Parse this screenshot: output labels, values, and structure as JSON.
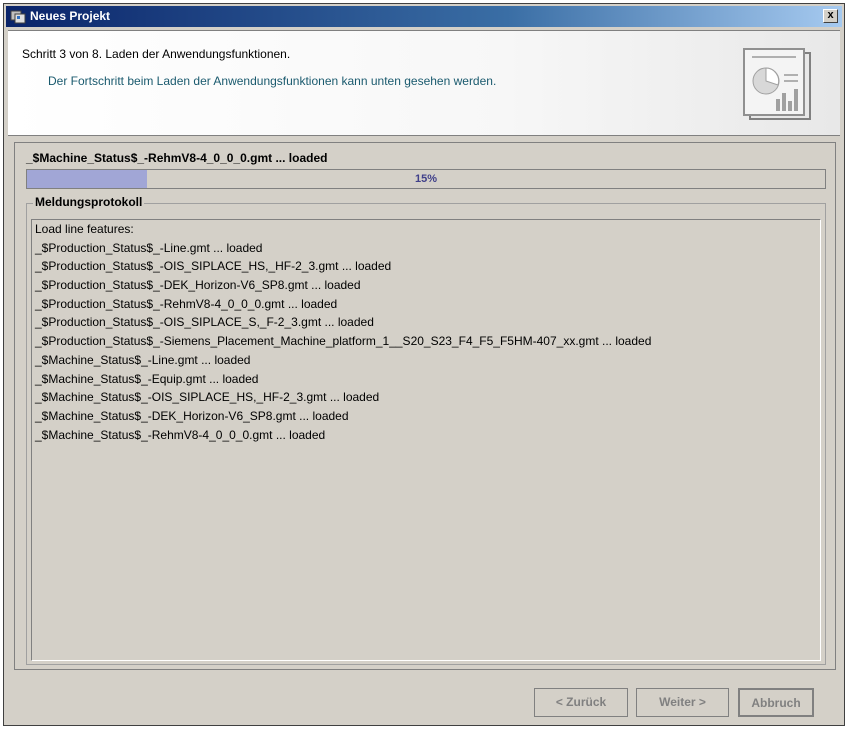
{
  "window": {
    "title": "Neues Projekt",
    "close_label": "x"
  },
  "header": {
    "step_text": "Schritt 3 von 8. Laden der Anwendungsfunktionen.",
    "sub_text": "Der Fortschritt beim Laden der Anwendungsfunktionen kann unten gesehen werden."
  },
  "status": {
    "current": "_$Machine_Status$_-RehmV8-4_0_0_0.gmt ... loaded"
  },
  "progress": {
    "label": "15%",
    "value": 0.15
  },
  "log": {
    "label": "Meldungsprotokoll",
    "lines": [
      "Load line features:",
      "_$Production_Status$_-Line.gmt ... loaded",
      "_$Production_Status$_-OIS_SIPLACE_HS,_HF-2_3.gmt ... loaded",
      "_$Production_Status$_-DEK_Horizon-V6_SP8.gmt ... loaded",
      "_$Production_Status$_-RehmV8-4_0_0_0.gmt ... loaded",
      "_$Production_Status$_-OIS_SIPLACE_S,_F-2_3.gmt ... loaded",
      "_$Production_Status$_-Siemens_Placement_Machine_platform_1__S20_S23_F4_F5_F5HM-407_xx.gmt ... loaded",
      "_$Machine_Status$_-Line.gmt ... loaded",
      "_$Machine_Status$_-Equip.gmt ... loaded",
      "_$Machine_Status$_-OIS_SIPLACE_HS,_HF-2_3.gmt ... loaded",
      "_$Machine_Status$_-DEK_Horizon-V6_SP8.gmt ... loaded",
      "_$Machine_Status$_-RehmV8-4_0_0_0.gmt ... loaded"
    ]
  },
  "buttons": {
    "back": "< Zurück",
    "next": "Weiter >",
    "cancel": "Abbruch"
  },
  "icons": {
    "app": "project-wizard-icon",
    "header": "chart-document-icon",
    "close": "close-icon"
  }
}
